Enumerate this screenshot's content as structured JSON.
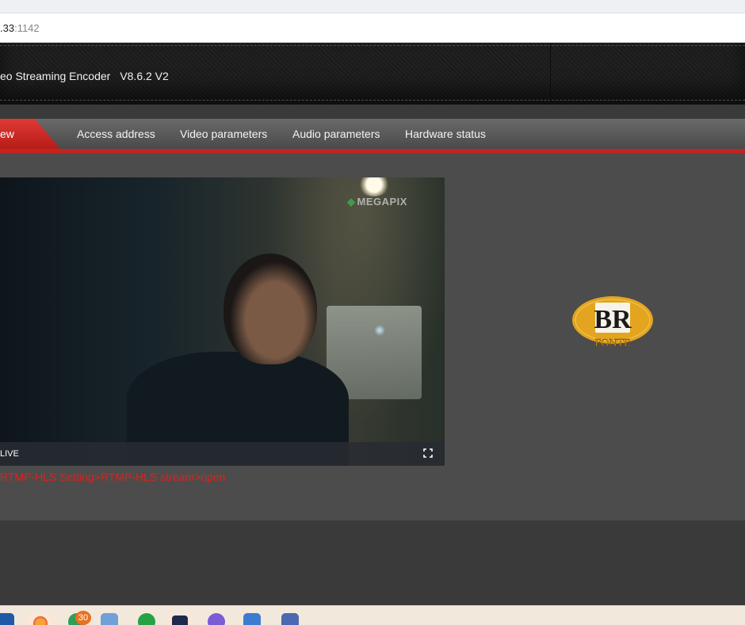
{
  "browser": {
    "url_host": ".33",
    "url_port": ":1142"
  },
  "app": {
    "title": "eo Streaming Encoder",
    "version": "V8.6.2 V2"
  },
  "nav": {
    "active_label": "ew",
    "items": [
      "Access address",
      "Video parameters",
      "Audio parameters",
      "Hardware status"
    ]
  },
  "player": {
    "watermark": "MEGAPIX",
    "live_label": "LIVE"
  },
  "hint": "RTMP-HLS Setting>RTMP-HLS stream>open",
  "logo": {
    "monogram": "BR",
    "caption": "FONTE"
  },
  "taskbar": {
    "badge_count": "30"
  },
  "colors": {
    "accent_red": "#c9221f",
    "hint_red": "#e0201a",
    "header_bg": "#1e1e1e",
    "content_bg": "#4c4c4c"
  }
}
